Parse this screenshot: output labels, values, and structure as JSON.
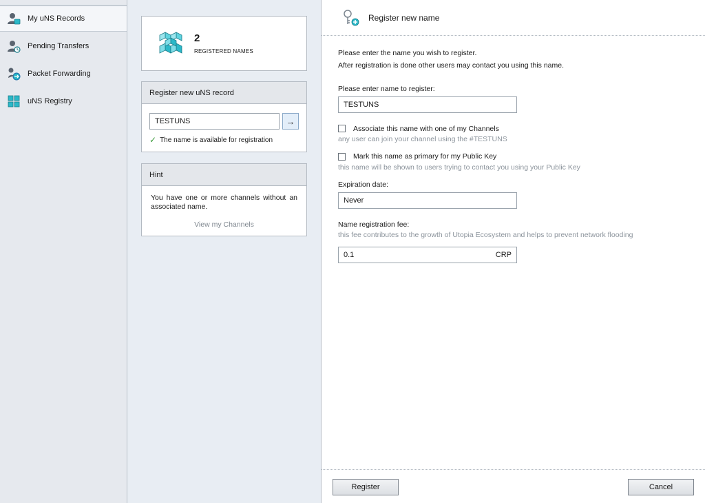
{
  "sidebar": {
    "items": [
      {
        "label": "My uNS Records",
        "icon": "user-records-icon"
      },
      {
        "label": "Pending Transfers",
        "icon": "user-transfer-icon"
      },
      {
        "label": "Packet Forwarding",
        "icon": "forwarding-icon"
      },
      {
        "label": "uNS Registry",
        "icon": "registry-cubes-icon"
      }
    ]
  },
  "stats": {
    "count": "2",
    "label": "REGISTERED NAMES"
  },
  "register_card": {
    "title": "Register new uNS record",
    "input_value": "TESTUNS",
    "availability": "The name is available for registration"
  },
  "hint_card": {
    "title": "Hint",
    "text": "You have one or more channels without an associated name.",
    "link": "View my Channels"
  },
  "form": {
    "title": "Register new name",
    "intro_1": "Please enter the name you wish to register.",
    "intro_2": "After registration is done other users may contact you using this name.",
    "name_label": "Please enter name to register:",
    "name_value": "TESTUNS",
    "assoc_label": "Associate this name with one of my Channels",
    "assoc_hint": "any user can join your channel using the #TESTUNS",
    "primary_label": "Mark this name as primary for my Public Key",
    "primary_hint": "this name will be shown to users trying to contact you using your Public Key",
    "expiration_label": "Expiration date:",
    "expiration_value": "Never",
    "fee_label": "Name registration fee:",
    "fee_hint": "this fee contributes to the growth of Utopia Ecosystem and helps to prevent network flooding",
    "fee_value": "0.1",
    "fee_unit": "CRP",
    "register_button": "Register",
    "cancel_button": "Cancel"
  },
  "colors": {
    "accent_cyan": "#2bb8c8",
    "check_green": "#3a9a3a"
  }
}
